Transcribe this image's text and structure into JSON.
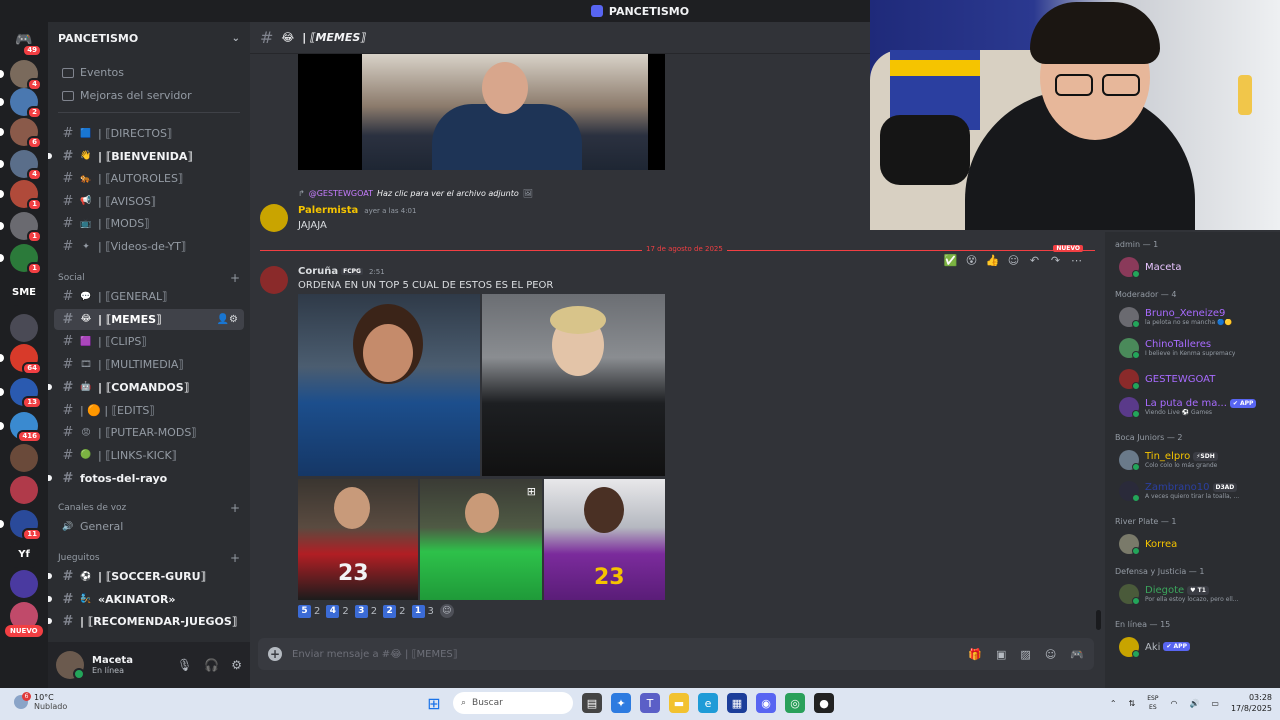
{
  "window": {
    "title": "PANCETISMO"
  },
  "rail": {
    "top_badge": "49",
    "servers": [
      {
        "label": "",
        "badge": "4",
        "color": "#7a6a5c"
      },
      {
        "label": "",
        "badge": "2",
        "color": "#4a78b0"
      },
      {
        "label": "",
        "badge": "6",
        "color": "#8a5a4a"
      },
      {
        "label": "",
        "badge": "4",
        "color": "#5a6e8a"
      },
      {
        "label": "",
        "badge": "1",
        "color": "#b04a3a"
      },
      {
        "label": "",
        "badge": "1",
        "color": "#6a6a70"
      },
      {
        "label": "",
        "badge": "1",
        "color": "#2b7a3a"
      },
      {
        "label": "SME",
        "badge": "",
        "color": "#1e1f22"
      },
      {
        "label": "",
        "badge": "",
        "color": "#4a4a55"
      },
      {
        "label": "",
        "badge": "64",
        "color": "#d83a2a"
      },
      {
        "label": "",
        "badge": "13",
        "color": "#2a5ab0"
      },
      {
        "label": "",
        "badge": "416",
        "color": "#3a8ad0"
      },
      {
        "label": "",
        "badge": "",
        "color": "#6a4a3a"
      },
      {
        "label": "",
        "badge": "",
        "color": "#b03a4a"
      },
      {
        "label": "",
        "badge": "11",
        "color": "#2a4a9a"
      },
      {
        "label": "Yf",
        "badge": "",
        "color": "#1e1f22"
      },
      {
        "label": "",
        "badge": "",
        "color": "#4a3aa0"
      },
      {
        "label": "",
        "badge": "",
        "color": "#c04a6a"
      }
    ],
    "nuevo": "NUEVO"
  },
  "sidebar": {
    "server_name": "PANCETISMO",
    "top_items": [
      {
        "label": "Eventos"
      },
      {
        "label": "Mejoras del servidor"
      }
    ],
    "channels_top": [
      {
        "emoji": "🟦",
        "name": "| ⟦DIRECTOS⟧",
        "unread": false
      },
      {
        "emoji": "👋",
        "name": "| ⟦BIENVENIDA⟧",
        "unread": true
      },
      {
        "emoji": "🐅",
        "name": "| ⟦AUTOROLES⟧",
        "unread": false
      },
      {
        "emoji": "📢",
        "name": "| ⟦AVISOS⟧",
        "unread": false
      },
      {
        "emoji": "📺",
        "name": "| ⟦MODS⟧",
        "unread": false
      },
      {
        "emoji": "✦",
        "name": "| ⟦Videos-de-YT⟧",
        "unread": false
      }
    ],
    "category_social": "Social",
    "channels_social": [
      {
        "emoji": "💬",
        "name": "| ⟦GENERAL⟧",
        "unread": false
      },
      {
        "emoji": "😂",
        "name": "| ⟦MEMES⟧",
        "unread": false,
        "active": true
      },
      {
        "emoji": "🟪",
        "name": "| ⟦CLIPS⟧",
        "unread": false
      },
      {
        "emoji": "🎞",
        "name": "| ⟦MULTIMEDIA⟧",
        "unread": false
      },
      {
        "emoji": "🤖",
        "name": "| ⟦COMANDOS⟧",
        "unread": true
      },
      {
        "emoji": "",
        "name": "| 🟠 | ⟦EDITS⟧",
        "unread": false
      },
      {
        "emoji": "😡",
        "name": "| ⟦PUTEAR-MODS⟧",
        "unread": false
      },
      {
        "emoji": "🟢",
        "name": "| ⟦LINKS-KICK⟧",
        "unread": false
      },
      {
        "emoji": "",
        "name": "fotos-del-rayo",
        "unread": true
      }
    ],
    "category_voice": "Canales de voz",
    "voice_channels": [
      {
        "name": "General"
      }
    ],
    "category_games": "Jueguitos",
    "channels_games": [
      {
        "emoji": "⚽",
        "name": "| ⟦SOCCER-GURU⟧",
        "unread": true
      },
      {
        "emoji": "🧞",
        "name": "«AKINATOR»",
        "unread": true
      },
      {
        "emoji": "",
        "name": "| ⟦RECOMENDAR-JUEGOS⟧",
        "unread": true
      }
    ],
    "user": {
      "name": "Maceta",
      "status": "En línea"
    }
  },
  "chat": {
    "channel_emoji": "😂",
    "channel_name": "| ⟦MEMES⟧",
    "msg1": {
      "reply_author": "@GESTEWGOAT",
      "reply_text": "Haz clic para ver el archivo adjunto",
      "author": "Palermista",
      "timestamp": "ayer a las 4:01",
      "text": "JAJAJA"
    },
    "divider_date": "17 de agosto de 2025",
    "divider_new": "NUEVO",
    "msg2": {
      "author": "Coruña",
      "tag": "FCPG",
      "timestamp": "2:51",
      "text": "ORDENA EN UN TOP 5 CUAL DE ESTOS ES EL PEOR"
    },
    "reactions": [
      {
        "key": "5",
        "count": "2"
      },
      {
        "key": "4",
        "count": "2"
      },
      {
        "key": "3",
        "count": "2"
      },
      {
        "key": "2",
        "count": "2"
      },
      {
        "key": "1",
        "count": "3"
      }
    ],
    "jersey_numbers": [
      "23",
      "23"
    ],
    "composer_placeholder": "Enviar mensaje a #😂 | ⟦MEMES⟧"
  },
  "members": {
    "groups": [
      {
        "title": "admin — 1",
        "members": [
          {
            "name": "Maceta",
            "color": "#e8c4ff",
            "sub": ""
          }
        ]
      },
      {
        "title": "Moderador — 4",
        "members": [
          {
            "name": "Bruno_Xeneize9",
            "color": "#a86bff",
            "sub": "la pelota no se mancha 🔵🟡"
          },
          {
            "name": "ChinoTalleres",
            "color": "#a86bff",
            "sub": "I believe in Kenma supremacy"
          },
          {
            "name": "GESTEWGOAT",
            "color": "#a86bff",
            "sub": ""
          },
          {
            "name": "La puta de ma...",
            "color": "#a86bff",
            "sub": "Viendo Live ⚽ Games",
            "badge": "✔ APP"
          }
        ]
      },
      {
        "title": "Boca Juniors — 2",
        "members": [
          {
            "name": "Tin_elpro",
            "color": "#f5c400",
            "sub": "Colo colo lo más grande",
            "badge": "⚡SDH"
          },
          {
            "name": "Zambrano10",
            "color": "#2b3fa0",
            "sub": "A veces quiero tirar la toalla, ...",
            "badge": "D3AD"
          }
        ]
      },
      {
        "title": "River Plate — 1",
        "members": [
          {
            "name": "Korrea",
            "color": "#f5c400",
            "sub": ""
          }
        ]
      },
      {
        "title": "Defensa y Justicia — 1",
        "members": [
          {
            "name": "Diegote",
            "color": "#3ba55c",
            "sub": "Por ella estoy locazo, pero ell...",
            "badge": "♥ T1"
          }
        ]
      },
      {
        "title": "En línea — 15",
        "members": [
          {
            "name": "Aki",
            "color": "#b5bac1",
            "sub": "",
            "badge": "✔ APP"
          }
        ]
      }
    ]
  },
  "taskbar": {
    "weather_temp": "10°C",
    "weather_desc": "Nublado",
    "weather_badge": "6",
    "search": "Buscar",
    "lang1": "ESP",
    "lang2": "ES",
    "time": "03:28",
    "date": "17/8/2025"
  },
  "colors": {
    "accent": "#5865f2",
    "unread_red": "#f23f43",
    "online": "#23a55a"
  }
}
